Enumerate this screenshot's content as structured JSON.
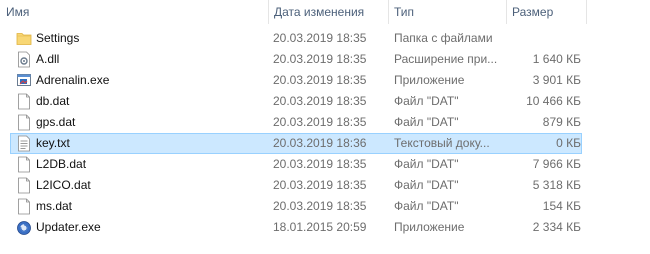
{
  "columns": {
    "name": "Имя",
    "date": "Дата изменения",
    "type": "Тип",
    "size": "Размер"
  },
  "files": [
    {
      "name": "Settings",
      "date": "20.03.2019 18:35",
      "type": "Папка с файлами",
      "size": "",
      "icon": "folder-icon"
    },
    {
      "name": "A.dll",
      "date": "20.03.2019 18:35",
      "type": "Расширение при...",
      "size": "1 640 КБ",
      "icon": "dll-file-icon"
    },
    {
      "name": "Adrenalin.exe",
      "date": "20.03.2019 18:35",
      "type": "Приложение",
      "size": "3 901 КБ",
      "icon": "exe-app-icon"
    },
    {
      "name": "db.dat",
      "date": "20.03.2019 18:35",
      "type": "Файл \"DAT\"",
      "size": "10 466 КБ",
      "icon": "blank-file-icon"
    },
    {
      "name": "gps.dat",
      "date": "20.03.2019 18:35",
      "type": "Файл \"DAT\"",
      "size": "879 КБ",
      "icon": "blank-file-icon"
    },
    {
      "name": "key.txt",
      "date": "20.03.2019 18:36",
      "type": "Текстовый доку...",
      "size": "0 КБ",
      "icon": "text-file-icon"
    },
    {
      "name": "L2DB.dat",
      "date": "20.03.2019 18:35",
      "type": "Файл \"DAT\"",
      "size": "7 966 КБ",
      "icon": "blank-file-icon"
    },
    {
      "name": "L2ICO.dat",
      "date": "20.03.2019 18:35",
      "type": "Файл \"DAT\"",
      "size": "5 318 КБ",
      "icon": "blank-file-icon"
    },
    {
      "name": "ms.dat",
      "date": "20.03.2019 18:35",
      "type": "Файл \"DAT\"",
      "size": "154 КБ",
      "icon": "blank-file-icon"
    },
    {
      "name": "Updater.exe",
      "date": "18.01.2015 20:59",
      "type": "Приложение",
      "size": "2 334 КБ",
      "icon": "updater-app-icon"
    }
  ],
  "selected_index": 5,
  "colors": {
    "selection_fill": "#cce8ff",
    "selection_border": "#99d1ff",
    "header_text": "#4c607a",
    "folder": "#f8d775"
  }
}
